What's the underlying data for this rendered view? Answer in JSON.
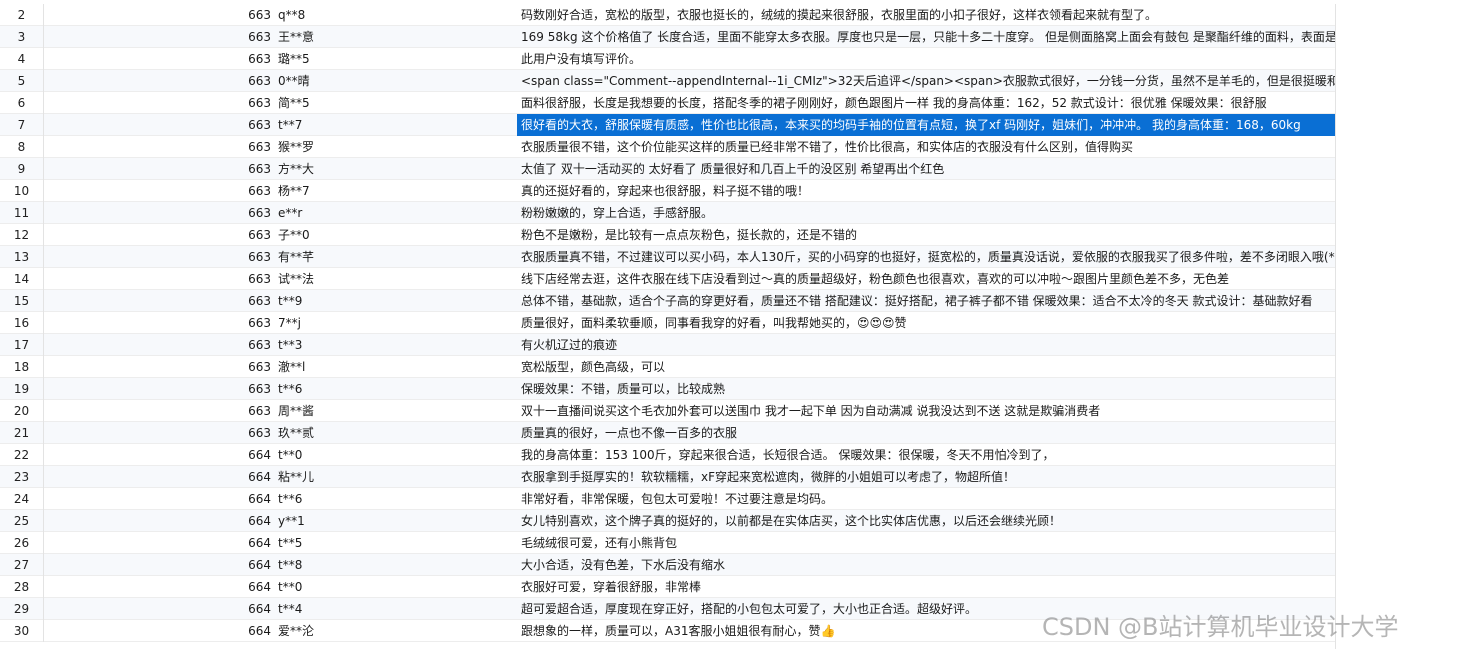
{
  "rows": [
    {
      "idx": "2",
      "num": "663",
      "name": "q**8",
      "content": "码数刚好合适，宽松的版型，衣服也挺长的，绒绒的摸起来很舒服，衣服里面的小扣子很好，这样衣领看起来就有型了。"
    },
    {
      "idx": "3",
      "num": "663",
      "name": "王**意",
      "content": "169 58kg 这个价格值了 长度合适，里面不能穿太多衣服。厚度也只是一层，只能十多二十度穿。 但是侧面胳窝上面会有鼓包 是聚酯纤维的面料，表面是"
    },
    {
      "idx": "4",
      "num": "663",
      "name": "璐**5",
      "content": "此用户没有填写评价。"
    },
    {
      "idx": "5",
      "num": "663",
      "name": "0**晴",
      "content": "<span class=\"Comment--appendInternal--1i_CMIz\">32天后追评</span><span>衣服款式很好，一分钱一分货，虽然不是羊毛的，但是很挺暖和防"
    },
    {
      "idx": "6",
      "num": "663",
      "name": "简**5",
      "content": "面料很舒服，长度是我想要的长度，搭配冬季的裙子刚刚好，颜色跟图片一样  我的身高体重：162，52  款式设计：很优雅   保暖效果：很舒服"
    },
    {
      "idx": "7",
      "num": "663",
      "name": "t**7",
      "content": "很好看的大衣，舒服保暖有质感，性价也比很高，本来买的均码手袖的位置有点短，换了xf 码刚好，姐妹们，冲冲冲。 我的身高体重：168，60kg"
    },
    {
      "idx": "8",
      "num": "663",
      "name": "猴**罗",
      "content": "衣服质量很不错，这个价位能买这样的质量已经非常不错了，性价比很高，和实体店的衣服没有什么区别，值得购买"
    },
    {
      "idx": "9",
      "num": "663",
      "name": "方**大",
      "content": "太值了 双十一活动买的 太好看了 质量很好和几百上千的没区别 希望再出个红色"
    },
    {
      "idx": "10",
      "num": "663",
      "name": "杨**7",
      "content": "真的还挺好看的，穿起来也很舒服，料子挺不错的哦！"
    },
    {
      "idx": "11",
      "num": "663",
      "name": "e**r",
      "content": "粉粉嫩嫩的，穿上合适，手感舒服。"
    },
    {
      "idx": "12",
      "num": "663",
      "name": "子**0",
      "content": "粉色不是嫩粉，是比较有一点点灰粉色，挺长款的，还是不错的"
    },
    {
      "idx": "13",
      "num": "663",
      "name": "有**芊",
      "content": "衣服质量真不错，不过建议可以买小码，本人130斤，买的小码穿的也挺好，挺宽松的，质量真没话说，爱依服的衣服我买了很多件啦，差不多闭眼入哦(*"
    },
    {
      "idx": "14",
      "num": "663",
      "name": "试**法",
      "content": "线下店经常去逛，这件衣服在线下店没看到过～真的质量超级好，粉色颜色也很喜欢，喜欢的可以冲啦～跟图片里颜色差不多，无色差"
    },
    {
      "idx": "15",
      "num": "663",
      "name": "t**9",
      "content": "总体不错，基础款，适合个子高的穿更好看，质量还不错 搭配建议：挺好搭配，裙子裤子都不错 保暖效果：适合不太冷的冬天 款式设计：基础款好看"
    },
    {
      "idx": "16",
      "num": "663",
      "name": "7**j",
      "content": "质量很好，面料柔软垂顺，同事看我穿的好看，叫我帮她买的，😍😍😍赞"
    },
    {
      "idx": "17",
      "num": "663",
      "name": "t**3",
      "content": "有火机辽过的痕迹"
    },
    {
      "idx": "18",
      "num": "663",
      "name": "澈**l",
      "content": "宽松版型，颜色高级，可以"
    },
    {
      "idx": "19",
      "num": "663",
      "name": "t**6",
      "content": "保暖效果：不错，质量可以，比较成熟"
    },
    {
      "idx": "20",
      "num": "663",
      "name": "周**酱",
      "content": "双十一直播间说买这个毛衣加外套可以送围巾 我才一起下单  因为自动满减 说我没达到不送 这就是欺骗消费者"
    },
    {
      "idx": "21",
      "num": "663",
      "name": "玖**贰",
      "content": "质量真的很好，一点也不像一百多的衣服"
    },
    {
      "idx": "22",
      "num": "664",
      "name": "t**0",
      "content": "我的身高体重：153    100斤，穿起来很合适，长短很合适。 保暖效果：很保暖，冬天不用怕冷到了，"
    },
    {
      "idx": "23",
      "num": "664",
      "name": "粘**儿",
      "content": "衣服拿到手挺厚实的！软软糯糯，xF穿起来宽松遮肉，微胖的小姐姐可以考虑了，物超所值！"
    },
    {
      "idx": "24",
      "num": "664",
      "name": "t**6",
      "content": "非常好看，非常保暖，包包太可爱啦！不过要注意是均码。"
    },
    {
      "idx": "25",
      "num": "664",
      "name": "y**1",
      "content": "女儿特别喜欢，这个牌子真的挺好的，以前都是在实体店买，这个比实体店优惠，以后还会继续光顾！"
    },
    {
      "idx": "26",
      "num": "664",
      "name": "t**5",
      "content": "毛绒绒很可爱，还有小熊背包"
    },
    {
      "idx": "27",
      "num": "664",
      "name": "t**8",
      "content": "大小合适，没有色差，下水后没有缩水"
    },
    {
      "idx": "28",
      "num": "664",
      "name": "t**0",
      "content": "衣服好可爱，穿着很舒服，非常棒"
    },
    {
      "idx": "29",
      "num": "664",
      "name": "t**4",
      "content": "超可爱超合适，厚度现在穿正好，搭配的小包包太可爱了，大小也正合适。超级好评。"
    },
    {
      "idx": "30",
      "num": "664",
      "name": "爱**沦",
      "content": "跟想象的一样，质量可以，A31客服小姐姐很有耐心，赞👍"
    }
  ],
  "selected_row": "7",
  "watermark": "CSDN @B站计算机毕业设计大学"
}
